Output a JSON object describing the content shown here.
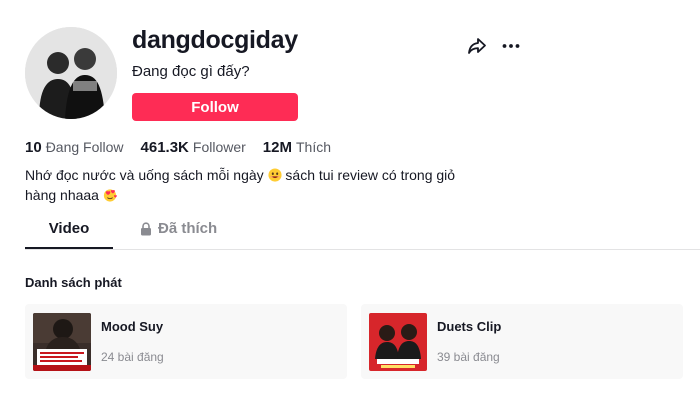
{
  "profile": {
    "username": "dangdocgiday",
    "nickname": "Đang đọc gì đấy?",
    "avatar_icon": "avatar-photo-two-people",
    "follow_label": "Follow"
  },
  "actions": {
    "share_icon": "share-icon",
    "more_icon": "more-icon"
  },
  "stats": [
    {
      "value": "10",
      "label": "Đang Follow"
    },
    {
      "value": "461.3K",
      "label": "Follower"
    },
    {
      "value": "12M",
      "label": "Thích"
    }
  ],
  "bio": {
    "line1_a": "Nhớ đọc nước và uống sách mỗi ngày",
    "line1_b": "sách tui review có trong giỏ",
    "line2": "hàng nhaaa"
  },
  "tabs": {
    "video": "Video",
    "liked": "Đã thích"
  },
  "playlists": {
    "title": "Danh sách phát",
    "items": [
      {
        "name": "Mood Suy",
        "count": "24 bài đăng"
      },
      {
        "name": "Duets Clip",
        "count": "39 bài đăng"
      }
    ]
  },
  "colors": {
    "accent": "#fe2c55",
    "text": "#161823",
    "muted": "#8a8b91"
  }
}
